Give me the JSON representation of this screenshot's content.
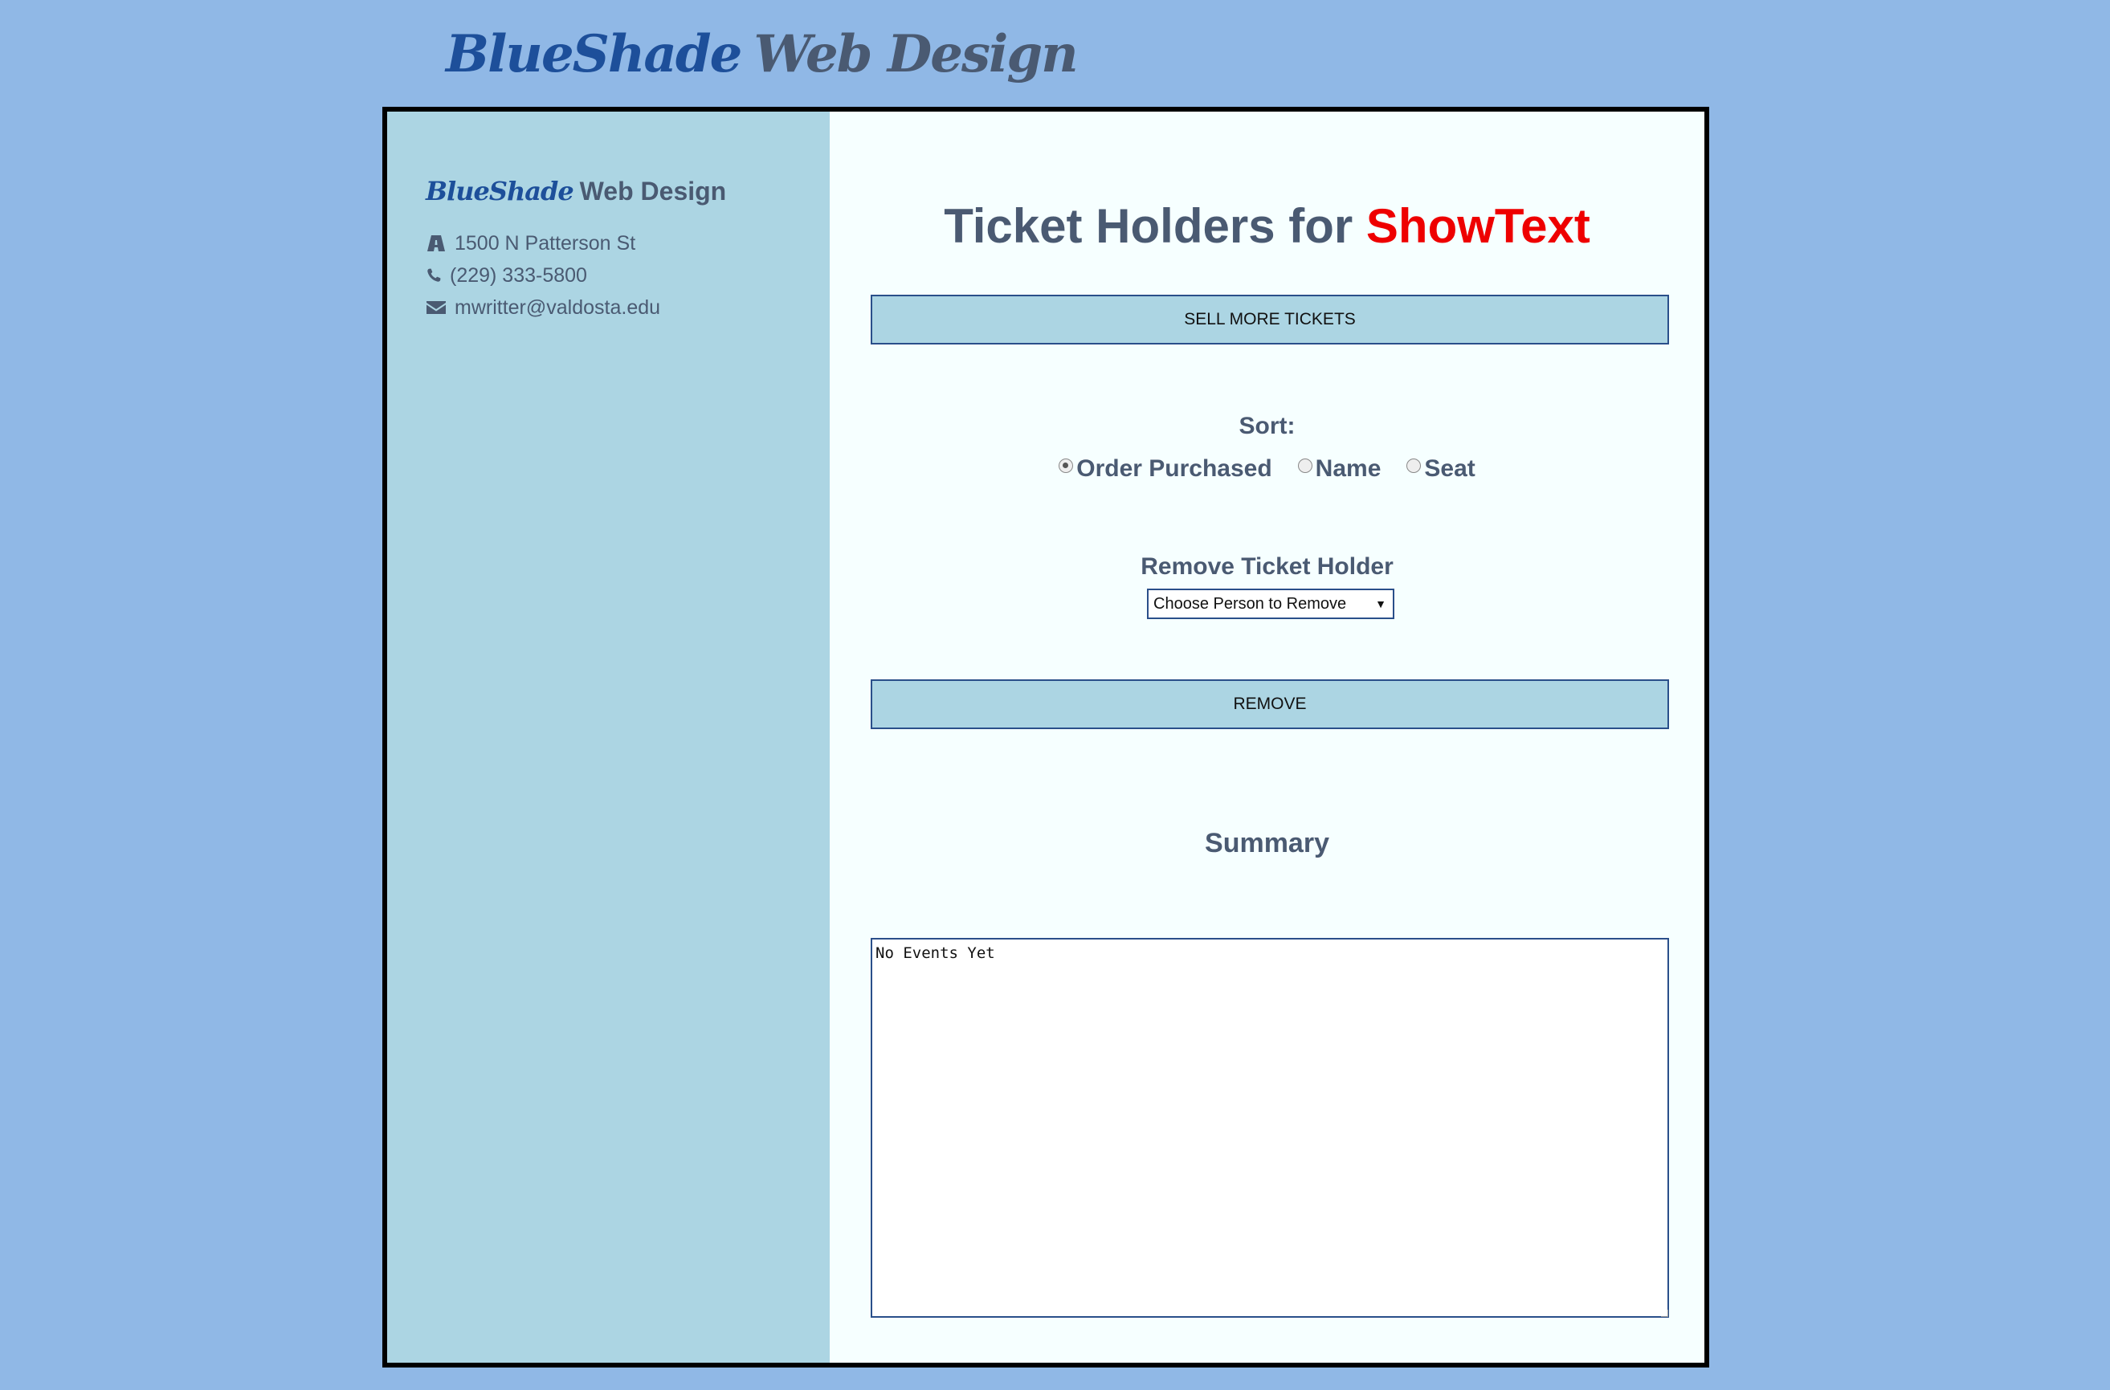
{
  "header": {
    "brand_part1": "BlueShade",
    "brand_part2": "Web Design"
  },
  "sidebar": {
    "brand_part1": "BlueShade",
    "brand_part2": "Web Design",
    "address": "1500 N Patterson St",
    "phone": "(229) 333-5800",
    "email": "mwritter@valdosta.edu",
    "icons": [
      "road-icon",
      "phone-icon",
      "envelope-icon"
    ]
  },
  "main": {
    "title_prefix": "Ticket Holders for",
    "title_show": "ShowText",
    "sell_button_label": "SELL MORE TICKETS",
    "sort": {
      "label": "Sort:",
      "options": [
        {
          "label": "Order Purchased",
          "checked": true
        },
        {
          "label": "Name",
          "checked": false
        },
        {
          "label": "Seat",
          "checked": false
        }
      ]
    },
    "remove": {
      "label": "Remove Ticket Holder",
      "select_value": "Choose Person to Remove",
      "button_label": "REMOVE"
    },
    "summary": {
      "heading": "Summary",
      "text": "No Events Yet"
    }
  },
  "colors": {
    "page_background": "#90b8e6",
    "sidebar_background": "#acd5e3",
    "content_background": "#f6ffff",
    "brand_blue": "#1d4f9a",
    "text_slate": "#4a5a72",
    "show_red": "#ee0000",
    "button_border": "#2a4f8a"
  }
}
